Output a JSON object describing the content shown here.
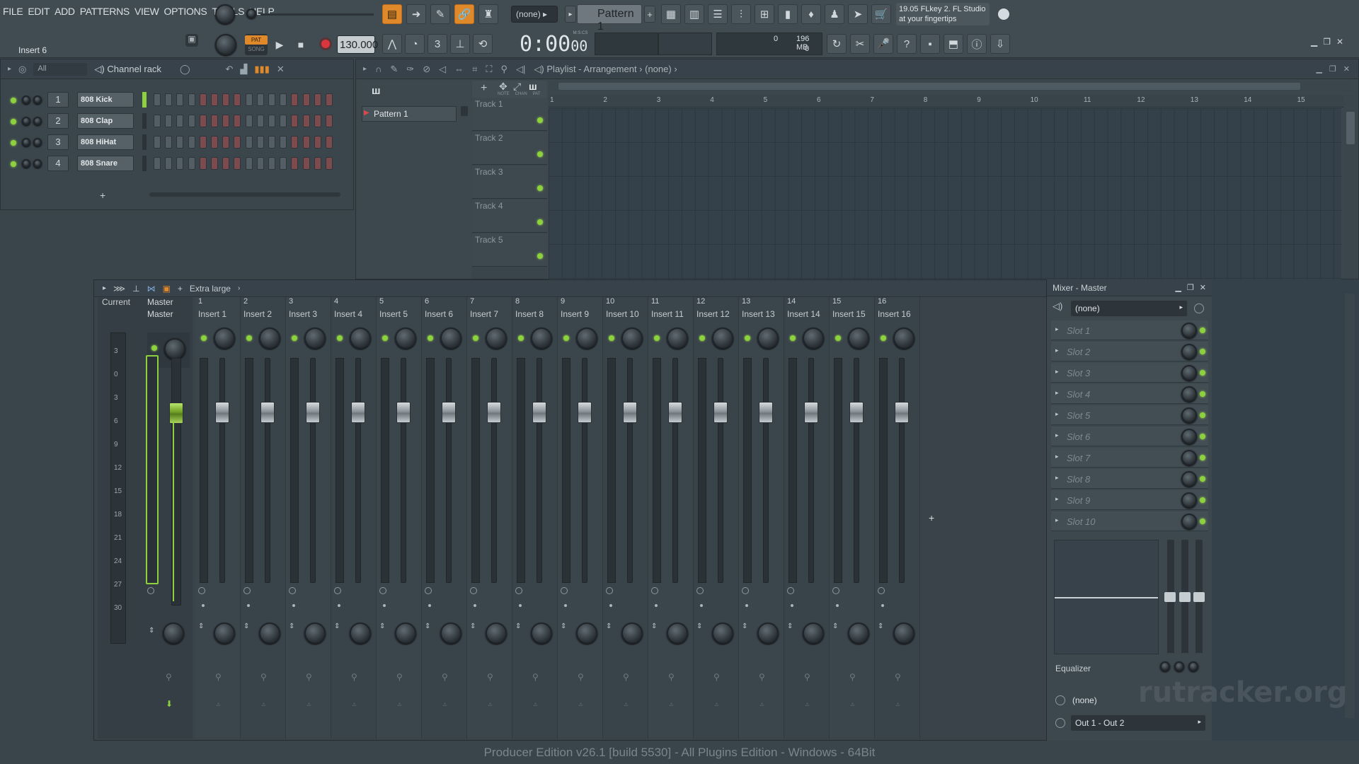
{
  "menu": [
    "FILE",
    "EDIT",
    "ADD",
    "PATTERNS",
    "VIEW",
    "OPTIONS",
    "TOOLS",
    "HELP"
  ],
  "toolbar": {
    "hint": "Insert 6",
    "pat_label": "PAT",
    "song_label": "SONG",
    "tempo": "130.000",
    "pattern_selector": "(none)",
    "pattern_name": "Pattern 1",
    "time": "0:00",
    "time_sub": "00",
    "time_unit": "M:S:CS",
    "cpu": "0",
    "memory": "196 MB",
    "poly": "0",
    "news_title": "19.05  FLkey 2. FL Studio",
    "news_sub": "at your fingertips"
  },
  "channel_rack": {
    "filter": "All",
    "title": "Channel rack",
    "channels": [
      {
        "num": "1",
        "name": "808 Kick"
      },
      {
        "num": "2",
        "name": "808 Clap"
      },
      {
        "num": "3",
        "name": "808 HiHat"
      },
      {
        "num": "4",
        "name": "808 Snare"
      }
    ],
    "add": "+"
  },
  "playlist": {
    "title": "Playlist - Arrangement",
    "crumb": "(none)",
    "pattern_item": "Pattern 1",
    "ruler": [
      "1",
      "2",
      "3",
      "4",
      "5",
      "6",
      "7",
      "8",
      "9",
      "10",
      "11",
      "12",
      "13",
      "14",
      "15"
    ],
    "tracks": [
      "Track 1",
      "Track 2",
      "Track 3",
      "Track 4",
      "Track 5"
    ],
    "tool_labels": [
      "NOTE",
      "CHAN",
      "PAT"
    ]
  },
  "mixer": {
    "view": "Extra large",
    "current": "Current",
    "master_num": "Master",
    "master_label": "Master",
    "scale": [
      "3",
      "0",
      "3",
      "6",
      "9",
      "12",
      "15",
      "18",
      "21",
      "24",
      "27",
      "30"
    ],
    "inserts": [
      {
        "num": "1",
        "label": "Insert 1"
      },
      {
        "num": "2",
        "label": "Insert 2"
      },
      {
        "num": "3",
        "label": "Insert 3"
      },
      {
        "num": "4",
        "label": "Insert 4"
      },
      {
        "num": "5",
        "label": "Insert 5"
      },
      {
        "num": "6",
        "label": "Insert 6"
      },
      {
        "num": "7",
        "label": "Insert 7"
      },
      {
        "num": "8",
        "label": "Insert 8"
      },
      {
        "num": "9",
        "label": "Insert 9"
      },
      {
        "num": "10",
        "label": "Insert 10"
      },
      {
        "num": "11",
        "label": "Insert 11"
      },
      {
        "num": "12",
        "label": "Insert 12"
      },
      {
        "num": "13",
        "label": "Insert 13"
      },
      {
        "num": "14",
        "label": "Insert 14"
      },
      {
        "num": "15",
        "label": "Insert 15"
      },
      {
        "num": "16",
        "label": "Insert 16"
      }
    ]
  },
  "mixer_master": {
    "title": "Mixer - Master",
    "preset": "(none)",
    "slots": [
      "Slot 1",
      "Slot 2",
      "Slot 3",
      "Slot 4",
      "Slot 5",
      "Slot 6",
      "Slot 7",
      "Slot 8",
      "Slot 9",
      "Slot 10"
    ],
    "eq_label": "Equalizer",
    "input": "(none)",
    "output": "Out 1 - Out 2"
  },
  "watermark": "rutracker.org",
  "status": "Producer Edition v26.1 [build 5530] - All Plugins Edition - Windows - 64Bit",
  "colors": {
    "accent": "#e0892b",
    "led": "#8ed13e",
    "bg": "#3a444b"
  }
}
